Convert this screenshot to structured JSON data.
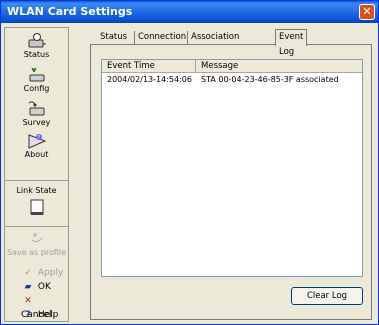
{
  "window": {
    "title": "WLAN Card Settings"
  },
  "sidebar": {
    "items": [
      {
        "label": "Status",
        "icon": "status-icon"
      },
      {
        "label": "Config",
        "icon": "config-icon"
      },
      {
        "label": "Survey",
        "icon": "survey-icon"
      },
      {
        "label": "About",
        "icon": "about-icon"
      },
      {
        "label": "Link State",
        "icon": "link-state-icon"
      },
      {
        "label": "Save as profile",
        "icon": "save-profile-icon",
        "enabled": false
      }
    ],
    "actions": {
      "apply": "Apply",
      "ok": "OK",
      "cancel": "Cancel",
      "help": "Help"
    }
  },
  "tabs": [
    "Status",
    "Connection",
    "Association Table",
    "Event Log"
  ],
  "active_tab": "Event Log",
  "event_log": {
    "columns": [
      "Event Time",
      "Message"
    ],
    "rows": [
      {
        "time": "2004/02/13-14:54:06",
        "message": "STA 00-04-23-46-85-3F associated"
      }
    ]
  },
  "buttons": {
    "clear_log": "Clear Log"
  },
  "colors": {
    "titlebar": "#0a52d6",
    "close": "#d9531e",
    "panel": "#ece9d8"
  }
}
